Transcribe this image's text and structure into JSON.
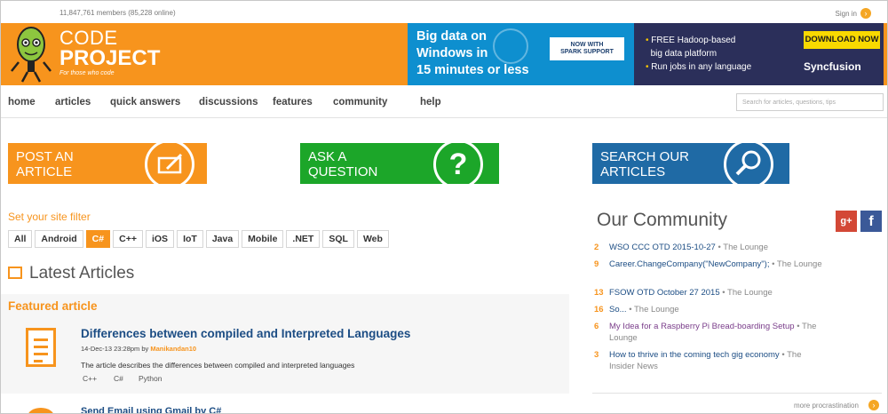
{
  "top": {
    "members": "11,847,761 members (85,228 online)",
    "signin": "Sign in"
  },
  "logo": {
    "line1": "CODE",
    "line2": "PROJECT",
    "tagline": "For those who code"
  },
  "ad": {
    "title_lines": [
      "Big data on",
      "Windows in",
      "15 minutes or less"
    ],
    "badge_lines": [
      "NOW WITH",
      "SPARK SUPPORT"
    ],
    "bullets": [
      "FREE Hadoop-based",
      "big data platform",
      "Run jobs in any language"
    ],
    "download": "DOWNLOAD NOW",
    "brand": "Syncfusion"
  },
  "nav": {
    "items": [
      "home",
      "articles",
      "quick answers",
      "discussions",
      "features",
      "community",
      "help"
    ],
    "search_placeholder": "Search for articles, questions, tips"
  },
  "actions": {
    "post": [
      "POST AN",
      "ARTICLE"
    ],
    "ask": [
      "ASK A",
      "QUESTION"
    ],
    "search": [
      "SEARCH OUR",
      "ARTICLES"
    ]
  },
  "filter": {
    "title": "Set your site filter",
    "chips": [
      "All",
      "Android",
      "C#",
      "C++",
      "iOS",
      "IoT",
      "Java",
      "Mobile",
      ".NET",
      "SQL",
      "Web"
    ],
    "active": "C#"
  },
  "latest": {
    "title": "Latest Articles",
    "featured_label": "Featured article",
    "article": {
      "title": "Differences between compiled and Interpreted Languages",
      "date": "14-Dec-13 23:28pm by",
      "author": "Manikandan10",
      "description": "The article describes the differences between compiled and interpreted languages",
      "tags": [
        "C++",
        "C#",
        "Python"
      ]
    },
    "next_title": "Send Email using Gmail by C#"
  },
  "community": {
    "title": "Our Community",
    "gplus": "g+",
    "facebook": "f",
    "items": [
      {
        "count": "2",
        "text": "WSO CCC OTD 2015-10-27",
        "where": "The Lounge"
      },
      {
        "count": "9",
        "text": "Career.ChangeCompany(\"NewCompany\");",
        "where": "The Lounge"
      },
      {
        "count": "13",
        "text": "FSOW OTD October 27 2015",
        "where": "The Lounge"
      },
      {
        "count": "16",
        "text": "So...",
        "where": "The Lounge"
      },
      {
        "count": "6",
        "text": "My Idea for a Raspberry Pi Bread-boarding Setup",
        "where": "The Lounge"
      },
      {
        "count": "3",
        "text": "How to thrive in the coming tech gig economy",
        "where": "The Insider News"
      }
    ],
    "more": "more procrastination"
  },
  "colors": {
    "brand_orange": "#f7941d",
    "ask_green": "#1ca629",
    "search_blue": "#1f6aa5",
    "link_blue": "#1c4d84"
  }
}
